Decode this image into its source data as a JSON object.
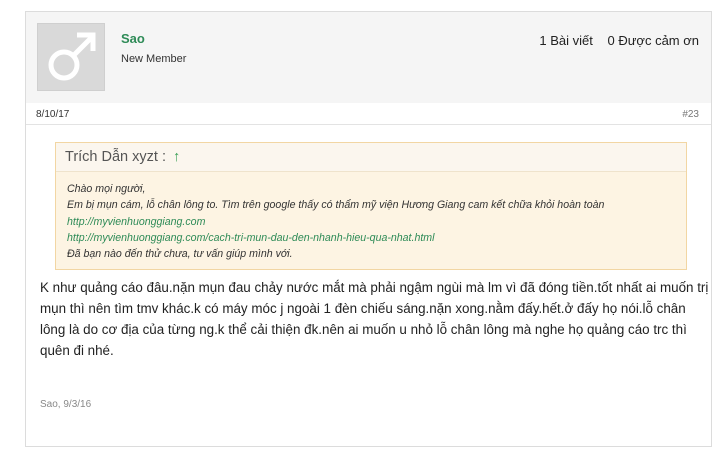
{
  "user": {
    "name": "Sao",
    "title": "New Member",
    "posts": "1 Bài viết",
    "thanks": "0 Được cảm ơn"
  },
  "post": {
    "date": "8/10/17",
    "number": "#23"
  },
  "quote": {
    "author": "Trích Dẫn xyzt :",
    "arrow": "↑",
    "lines": [
      "Chào mọi người,",
      "Em bị mụn cám, lỗ chân lông to. Tìm trên google thấy có thẩm mỹ viện Hương Giang cam kết chữa khỏi hoàn toàn",
      "http://myvienhuonggiang.com",
      "http://myvienhuonggiang.com/cach-tri-mun-dau-den-nhanh-hieu-qua-nhat.html",
      "Đã bạn nào đến thử chưa, tư vấn giúp mình với."
    ]
  },
  "message": "K như quảng cáo đâu.nặn mụn đau chảy nước mắt mà phải ngậm ngùi mà lm vì đã đóng tiền.tốt nhất ai muốn trị mụn thì nên tìm tmv khác.k có máy móc j ngoài 1 đèn chiếu sáng.nặn xong.nằm đấy.hết.ở đấy họ nói.lỗ chân lông là do cơ địa của từng ng.k thể cải thiện đk.nên ai muốn u nhỏ lỗ chân lông mà nghe họ quảng cáo trc thì quên đi nhé.",
  "footer": {
    "signature": "Sao, 9/3/16"
  }
}
